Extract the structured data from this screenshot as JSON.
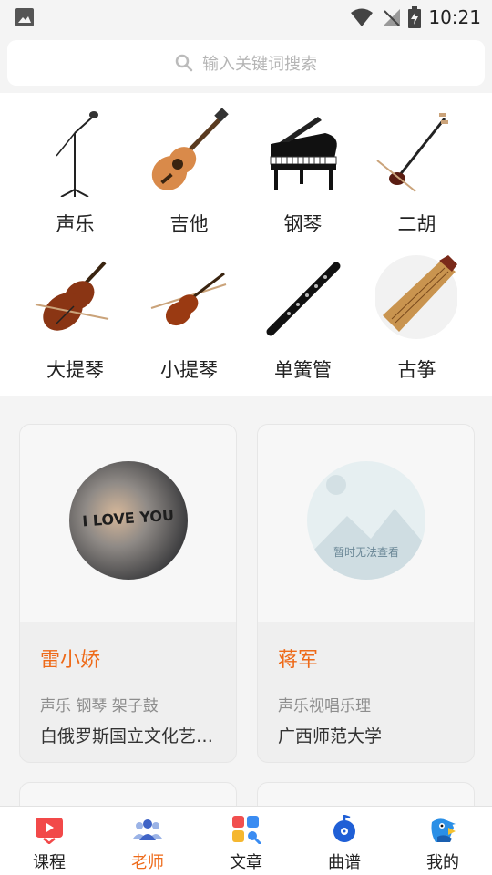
{
  "status_bar": {
    "time": "10:21"
  },
  "search": {
    "placeholder": "输入关键词搜索"
  },
  "instruments": [
    {
      "label": "声乐",
      "icon": "microphone-icon"
    },
    {
      "label": "吉他",
      "icon": "guitar-icon"
    },
    {
      "label": "钢琴",
      "icon": "piano-icon"
    },
    {
      "label": "二胡",
      "icon": "erhu-icon"
    },
    {
      "label": "大提琴",
      "icon": "cello-icon"
    },
    {
      "label": "小提琴",
      "icon": "violin-icon"
    },
    {
      "label": "单簧管",
      "icon": "clarinet-icon"
    },
    {
      "label": "古筝",
      "icon": "guzheng-icon"
    }
  ],
  "teachers": [
    {
      "name": "雷小娇",
      "tags": "声乐 钢琴 架子鼓",
      "school": "白俄罗斯国立文化艺术大学",
      "avatar_text": "I LOVE YOU"
    },
    {
      "name": "蒋军",
      "tags": "声乐视唱乐理",
      "school": "广西师范大学",
      "avatar_text": "暂时无法查看"
    }
  ],
  "tabs": [
    {
      "label": "课程",
      "icon": "course-play-icon",
      "active": false
    },
    {
      "label": "老师",
      "icon": "teachers-icon",
      "active": true
    },
    {
      "label": "文章",
      "icon": "articles-icon",
      "active": false
    },
    {
      "label": "曲谱",
      "icon": "music-score-icon",
      "active": false
    },
    {
      "label": "我的",
      "icon": "bird-profile-icon",
      "active": false
    }
  ],
  "colors": {
    "accent": "#ee6a19",
    "tag_gray": "#8d8d8d"
  }
}
